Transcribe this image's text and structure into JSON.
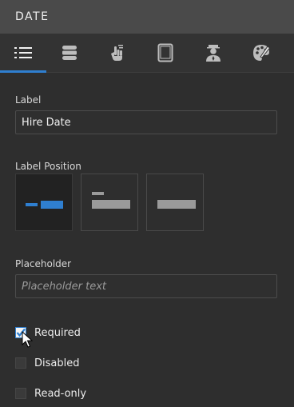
{
  "header": {
    "title": "DATE"
  },
  "tabs": [
    {
      "icon": "list-icon",
      "active": true
    },
    {
      "icon": "database-icon",
      "active": false
    },
    {
      "icon": "touch-hand-icon",
      "active": false
    },
    {
      "icon": "tablet-icon",
      "active": false
    },
    {
      "icon": "user-secure-icon",
      "active": false
    },
    {
      "icon": "palette-icon",
      "active": false
    }
  ],
  "label_field": {
    "label": "Label",
    "value": "Hire Date"
  },
  "label_position": {
    "label": "Label Position",
    "options": [
      "left",
      "top",
      "hidden"
    ],
    "selected": "left"
  },
  "placeholder_field": {
    "label": "Placeholder",
    "value": "",
    "placeholder": "Placeholder text"
  },
  "checkboxes": {
    "required": {
      "label": "Required",
      "checked": true
    },
    "disabled": {
      "label": "Disabled",
      "checked": false
    },
    "readonly": {
      "label": "Read-only",
      "checked": false
    }
  },
  "colors": {
    "accent": "#2f7fd0",
    "background": "#2e2e2e",
    "header": "#4a4a4a"
  }
}
